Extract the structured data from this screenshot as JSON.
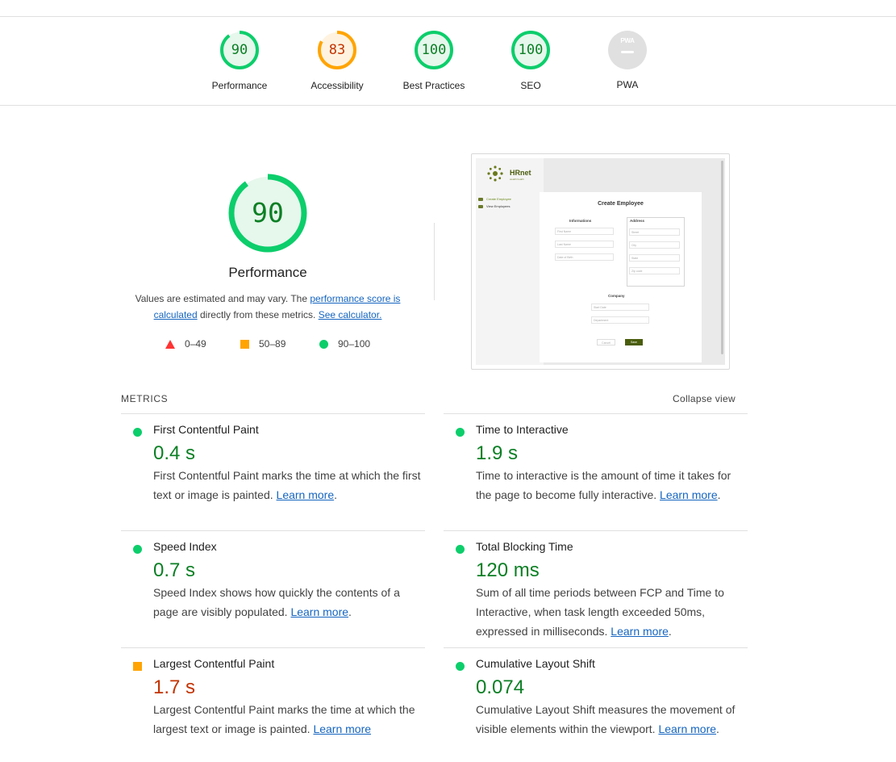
{
  "gauges": [
    {
      "label": "Performance",
      "score": "90",
      "fraction": 0.9,
      "color": "#0cce6b",
      "fill": "#e6f7ec",
      "text_color": "#0b7f24"
    },
    {
      "label": "Accessibility",
      "score": "83",
      "fraction": 0.83,
      "color": "#ffa400",
      "fill": "#fff3e0",
      "text_color": "#c33300"
    },
    {
      "label": "Best Practices",
      "score": "100",
      "fraction": 1.0,
      "color": "#0cce6b",
      "fill": "#e6f7ec",
      "text_color": "#0b7f24"
    },
    {
      "label": "SEO",
      "score": "100",
      "fraction": 1.0,
      "color": "#0cce6b",
      "fill": "#e6f7ec",
      "text_color": "#0b7f24"
    },
    {
      "label": "PWA",
      "badge": "PWA"
    }
  ],
  "performance": {
    "score": "90",
    "fraction": 0.9,
    "title": "Performance",
    "desc_pre": "Values are estimated and may vary. The ",
    "desc_link1": "performance score is calculated",
    "desc_mid": " directly from these metrics. ",
    "desc_link2": "See calculator.",
    "legend": [
      {
        "shape": "triangle",
        "range": "0–49",
        "color": "#ff3333"
      },
      {
        "shape": "square",
        "range": "50–89",
        "color": "#ffa400"
      },
      {
        "shape": "circle",
        "range": "90–100",
        "color": "#0cce6b"
      }
    ]
  },
  "screenshot": {
    "logo": "HRnet",
    "logo_sub": "wealth health",
    "nav": [
      "Create Employee",
      "View Employees"
    ],
    "card_title": "Create Employee",
    "informations_label": "Informations",
    "address_label": "Address",
    "company_label": "Company",
    "fields": [
      "First Name",
      "Last Name",
      "Date of Birth",
      "Street",
      "City",
      "State",
      "Zip code",
      "Start Date",
      "Department"
    ],
    "cancel": "Cancel",
    "save": "Save"
  },
  "metrics": {
    "heading": "METRICS",
    "collapse": "Collapse view",
    "learn_more": "Learn more",
    "items": [
      {
        "title": "First Contentful Paint",
        "value": "0.4 s",
        "status": "pass",
        "desc": "First Contentful Paint marks the time at which the first text or image is painted. "
      },
      {
        "title": "Time to Interactive",
        "value": "1.9 s",
        "status": "pass",
        "desc": "Time to interactive is the amount of time it takes for the page to become fully interactive. "
      },
      {
        "title": "Speed Index",
        "value": "0.7 s",
        "status": "pass",
        "desc": "Speed Index shows how quickly the contents of a page are visibly populated. "
      },
      {
        "title": "Total Blocking Time",
        "value": "120 ms",
        "status": "pass",
        "desc": "Sum of all time periods between FCP and Time to Interactive, when task length exceeded 50ms, expressed in milliseconds. "
      },
      {
        "title": "Largest Contentful Paint",
        "value": "1.7 s",
        "status": "average",
        "desc": "Largest Contentful Paint marks the time at which the largest text or image is painted. "
      },
      {
        "title": "Cumulative Layout Shift",
        "value": "0.074",
        "status": "pass",
        "desc": "Cumulative Layout Shift measures the movement of visible elements within the viewport. "
      }
    ]
  }
}
